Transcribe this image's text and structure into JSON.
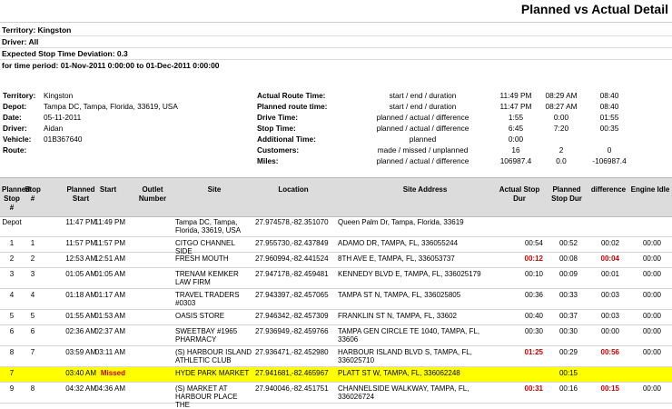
{
  "title": "Planned vs Actual Detail",
  "params": {
    "territory": "Territory: Kingston",
    "driver": "Driver: All",
    "deviation": "Expected Stop Time Deviation: 0.3",
    "period": "for time period: 01-Nov-2011 0:00:00 to 01-Dec-2011 0:00:00"
  },
  "info": {
    "territory_label": "Territory:",
    "territory_value": "Kingston",
    "depot_label": "Depot:",
    "depot_value": "Tampa DC, Tampa, Florida, 33619, USA",
    "date_label": "Date:",
    "date_value": "05-11-2011",
    "driver_label": "Driver:",
    "driver_value": "Aidan",
    "vehicle_label": "Vehicle:",
    "vehicle_value": "01B367640",
    "route_label": "Route:"
  },
  "metrics": [
    {
      "label": "Actual Route Time:",
      "desc": "start / end / duration",
      "v1": "11:49 PM",
      "v2": "08:29 AM",
      "v3": "08:40"
    },
    {
      "label": "Planned route time:",
      "desc": "start / end / duration",
      "v1": "11:47 PM",
      "v2": "08:27 AM",
      "v3": "08:40"
    },
    {
      "label": "Drive Time:",
      "desc": "planned / actual / difference",
      "v1": "1:55",
      "v2": "0:00",
      "v3": "01:55"
    },
    {
      "label": "Stop Time:",
      "desc": "planned / actual / difference",
      "v1": "6:45",
      "v2": "7:20",
      "v3": "00:35"
    },
    {
      "label": "Additional Time:",
      "desc": "planned",
      "v1": "0:00",
      "v2": "",
      "v3": ""
    },
    {
      "label": "Customers:",
      "desc": "made / missed / unplanned",
      "v1": "16",
      "v2": "2",
      "v3": "0"
    },
    {
      "label": "Miles:",
      "desc": "planned / actual / difference",
      "v1": "106987.4",
      "v2": "0.0",
      "v3": "-106987.4"
    }
  ],
  "columns": {
    "planned_stop": "Planned Stop #",
    "stop": "Stop #",
    "planned_start": "Planned Start",
    "start": "Start",
    "outlet": "Outlet Number",
    "site": "Site",
    "location": "Location",
    "address": "Site Address",
    "actual_dur": "Actual Stop Dur",
    "planned_dur": "Planned Stop Dur",
    "difference": "difference",
    "idle": "Engine Idle"
  },
  "rows": [
    {
      "ps": "Depot",
      "s": "",
      "pstart": "11:47 PM",
      "start": "11:49 PM",
      "outlet": "",
      "site": "Tampa DC, Tampa, Florida, 33619, USA",
      "loc": "27.974578,-82.351070",
      "addr": "Queen Palm Dr, Tampa, Florida, 33619",
      "adur": "",
      "pdur": "",
      "diff": "",
      "idle": ""
    },
    {
      "ps": "1",
      "s": "1",
      "pstart": "11:57 PM",
      "start": "11:57 PM",
      "outlet": "",
      "site": "CITGO CHANNEL SIDE",
      "loc": "27.955730,-82.437849",
      "addr": "ADAMO DR, TAMPA, FL, 336055244",
      "adur": "00:54",
      "pdur": "00:52",
      "diff": "00:02",
      "idle": "00:00"
    },
    {
      "ps": "2",
      "s": "2",
      "pstart": "12:53 AM",
      "start": "12:51 AM",
      "outlet": "",
      "site": "FRESH MOUTH",
      "loc": "27.960994,-82.441524",
      "addr": "8TH AVE E, TAMPA, FL, 336053737",
      "adur": "00:12",
      "pdur": "00:08",
      "diff": "00:04",
      "idle": "00:00"
    },
    {
      "ps": "3",
      "s": "3",
      "pstart": "01:05 AM",
      "start": "01:05 AM",
      "outlet": "",
      "site": "TRENAM KEMKER LAW FIRM",
      "loc": "27.947178,-82.459481",
      "addr": "KENNEDY BLVD E, TAMPA, FL, 336025179",
      "adur": "00:10",
      "pdur": "00:09",
      "diff": "00:01",
      "idle": "00:00"
    },
    {
      "ps": "4",
      "s": "4",
      "pstart": "01:18 AM",
      "start": "01:17 AM",
      "outlet": "",
      "site": "TRAVEL TRADERS #0303",
      "loc": "27.943397,-82.457065",
      "addr": "TAMPA ST N, TAMPA, FL, 336025805",
      "adur": "00:36",
      "pdur": "00:33",
      "diff": "00:03",
      "idle": "00:00"
    },
    {
      "ps": "5",
      "s": "5",
      "pstart": "01:55 AM",
      "start": "01:53 AM",
      "outlet": "",
      "site": "OASIS STORE",
      "loc": "27.946342,-82.457309",
      "addr": "FRANKLIN ST N, TAMPA, FL, 33602",
      "adur": "00:40",
      "pdur": "00:37",
      "diff": "00:03",
      "idle": "00:00"
    },
    {
      "ps": "6",
      "s": "6",
      "pstart": "02:36 AM",
      "start": "02:37 AM",
      "outlet": "",
      "site": "SWEETBAY #1965 PHARMACY",
      "loc": "27.936949,-82.459766",
      "addr": "TAMPA GEN CIRCLE TE 1040, TAMPA, FL, 33606",
      "adur": "00:30",
      "pdur": "00:30",
      "diff": "00:00",
      "idle": "00:00"
    },
    {
      "ps": "8",
      "s": "7",
      "pstart": "03:59 AM",
      "start": "03:11 AM",
      "outlet": "",
      "site": "(S) HARBOUR ISLAND ATHLETIC CLUB",
      "loc": "27.936471,-82.452980",
      "addr": "HARBOUR ISLAND BLVD S, TAMPA, FL, 336025710",
      "adur": "01:25",
      "pdur": "00:29",
      "diff": "00:56",
      "idle": "00:00"
    },
    {
      "ps": "7",
      "s": "",
      "pstart": "03:40 AM",
      "start": "Missed",
      "outlet": "",
      "site": "HYDE PARK MARKET",
      "loc": "27.941681,-82.465967",
      "addr": "PLATT ST W, TAMPA, FL, 336062248",
      "adur": "",
      "pdur": "00:15",
      "diff": "",
      "idle": ""
    },
    {
      "ps": "9",
      "s": "8",
      "pstart": "04:32 AM",
      "start": "04:36 AM",
      "outlet": "",
      "site": "(S) MARKET AT HARBOUR PLACE THE",
      "loc": "27.940046,-82.451751",
      "addr": "CHANNELSIDE WALKWAY, TAMPA, FL, 336026724",
      "adur": "00:31",
      "pdur": "00:16",
      "diff": "00:15",
      "idle": "00:00"
    }
  ],
  "colors": {
    "highlight": "#ffff00",
    "late": "#d00000",
    "header": "#dcdcdc"
  }
}
